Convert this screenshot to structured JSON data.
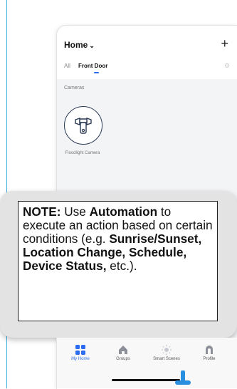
{
  "header": {
    "title": "Home",
    "title_chevron": "⌄",
    "add_symbol": "+"
  },
  "tabs": [
    {
      "label": "All",
      "active": false
    },
    {
      "label": "Front Door",
      "active": true
    }
  ],
  "section": {
    "label": "Cameras"
  },
  "device": {
    "name": "Floodlight Camera",
    "icon": "floodlight-camera-icon"
  },
  "note": {
    "lead": "NOTE:",
    "t1": " Use ",
    "b1": "Automation",
    "t2": " to execute an action based on certain conditions (e.g. ",
    "b2": "Sunrise/Sunset, Location Change, Schedule, Device Status,",
    "t3": " etc.)."
  },
  "nav": {
    "items": [
      {
        "label": "My Home",
        "icon": "grid-icon",
        "active": true
      },
      {
        "label": "Groups",
        "icon": "house-icon",
        "active": false
      },
      {
        "label": "Smart Scenes",
        "icon": "sun-icon",
        "active": false
      },
      {
        "label": "Profile",
        "icon": "profile-icon",
        "active": false
      }
    ]
  },
  "colors": {
    "accent": "#2b6cf0",
    "border_blue": "#3ab0e0",
    "icon_dark": "#2b3a55"
  }
}
